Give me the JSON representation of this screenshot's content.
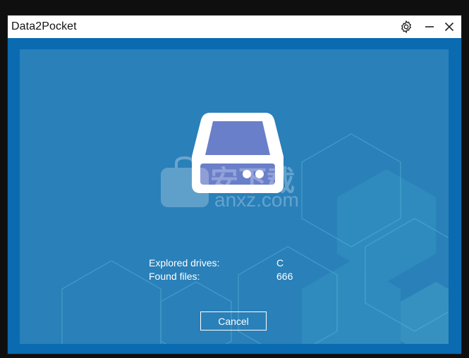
{
  "window": {
    "title": "Data2Pocket",
    "settings_icon": "gear-icon",
    "minimize_icon": "minimize-icon",
    "close_icon": "close-icon"
  },
  "scan": {
    "explored_label": "Explored drives:",
    "explored_value": "C",
    "found_label": "Found files:",
    "found_value": "666"
  },
  "actions": {
    "cancel_label": "Cancel"
  },
  "watermark": {
    "text_cn": "安下载",
    "text_url": "anxz.com"
  },
  "colors": {
    "window_bg": "#0a6bb1",
    "panel_bg": "#2a80b9",
    "drive_screen": "#6a7fc9",
    "text": "#ffffff"
  }
}
